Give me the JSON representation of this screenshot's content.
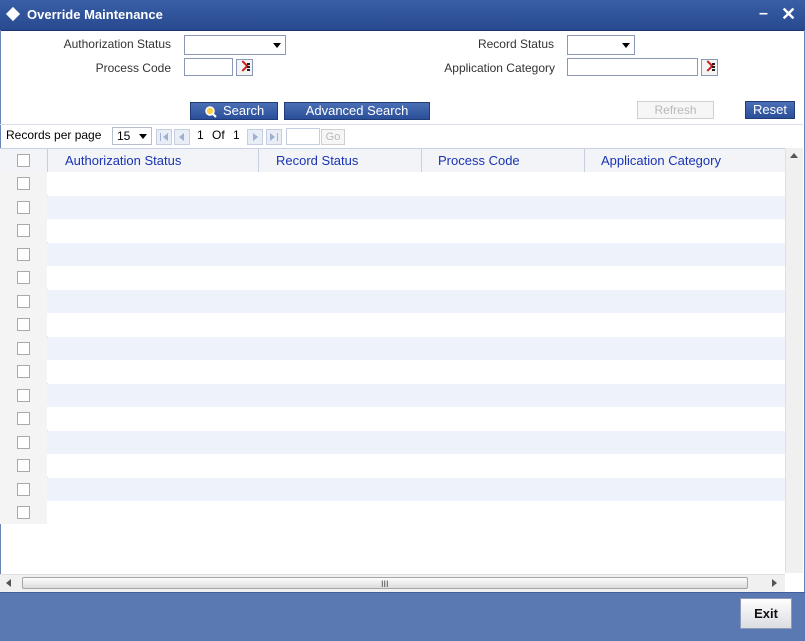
{
  "window": {
    "title": "Override Maintenance",
    "minimize_glyph": "–",
    "close_glyph": "✕"
  },
  "form": {
    "authorization_status_label": "Authorization Status",
    "record_status_label": "Record Status",
    "process_code_label": "Process Code",
    "application_category_label": "Application Category",
    "authorization_status_value": "",
    "record_status_value": "",
    "process_code_value": "",
    "application_category_value": ""
  },
  "actions": {
    "search": "Search",
    "advanced_search": "Advanced Search",
    "refresh": "Refresh",
    "reset": "Reset"
  },
  "pager": {
    "records_per_page_label": "Records per page",
    "records_per_page": "15",
    "current_page": "1",
    "of_label": "Of",
    "total_pages": "1",
    "go_label": "Go"
  },
  "grid": {
    "columns": [
      "Authorization Status",
      "Record Status",
      "Process Code",
      "Application Category"
    ],
    "row_count": 15
  },
  "scrollbar": {
    "grip": "III"
  },
  "footer": {
    "exit": "Exit"
  },
  "colors": {
    "title_bar": "#2e52a0",
    "column_header_text": "#1a33b2",
    "footer": "#5a79b3",
    "row_stripe": "#eef2fa"
  },
  "icons": [
    "diamond-icon",
    "minimize-icon",
    "close-icon",
    "lov-icon",
    "search-icon",
    "first-page-icon",
    "prev-page-icon",
    "next-page-icon",
    "last-page-icon"
  ]
}
